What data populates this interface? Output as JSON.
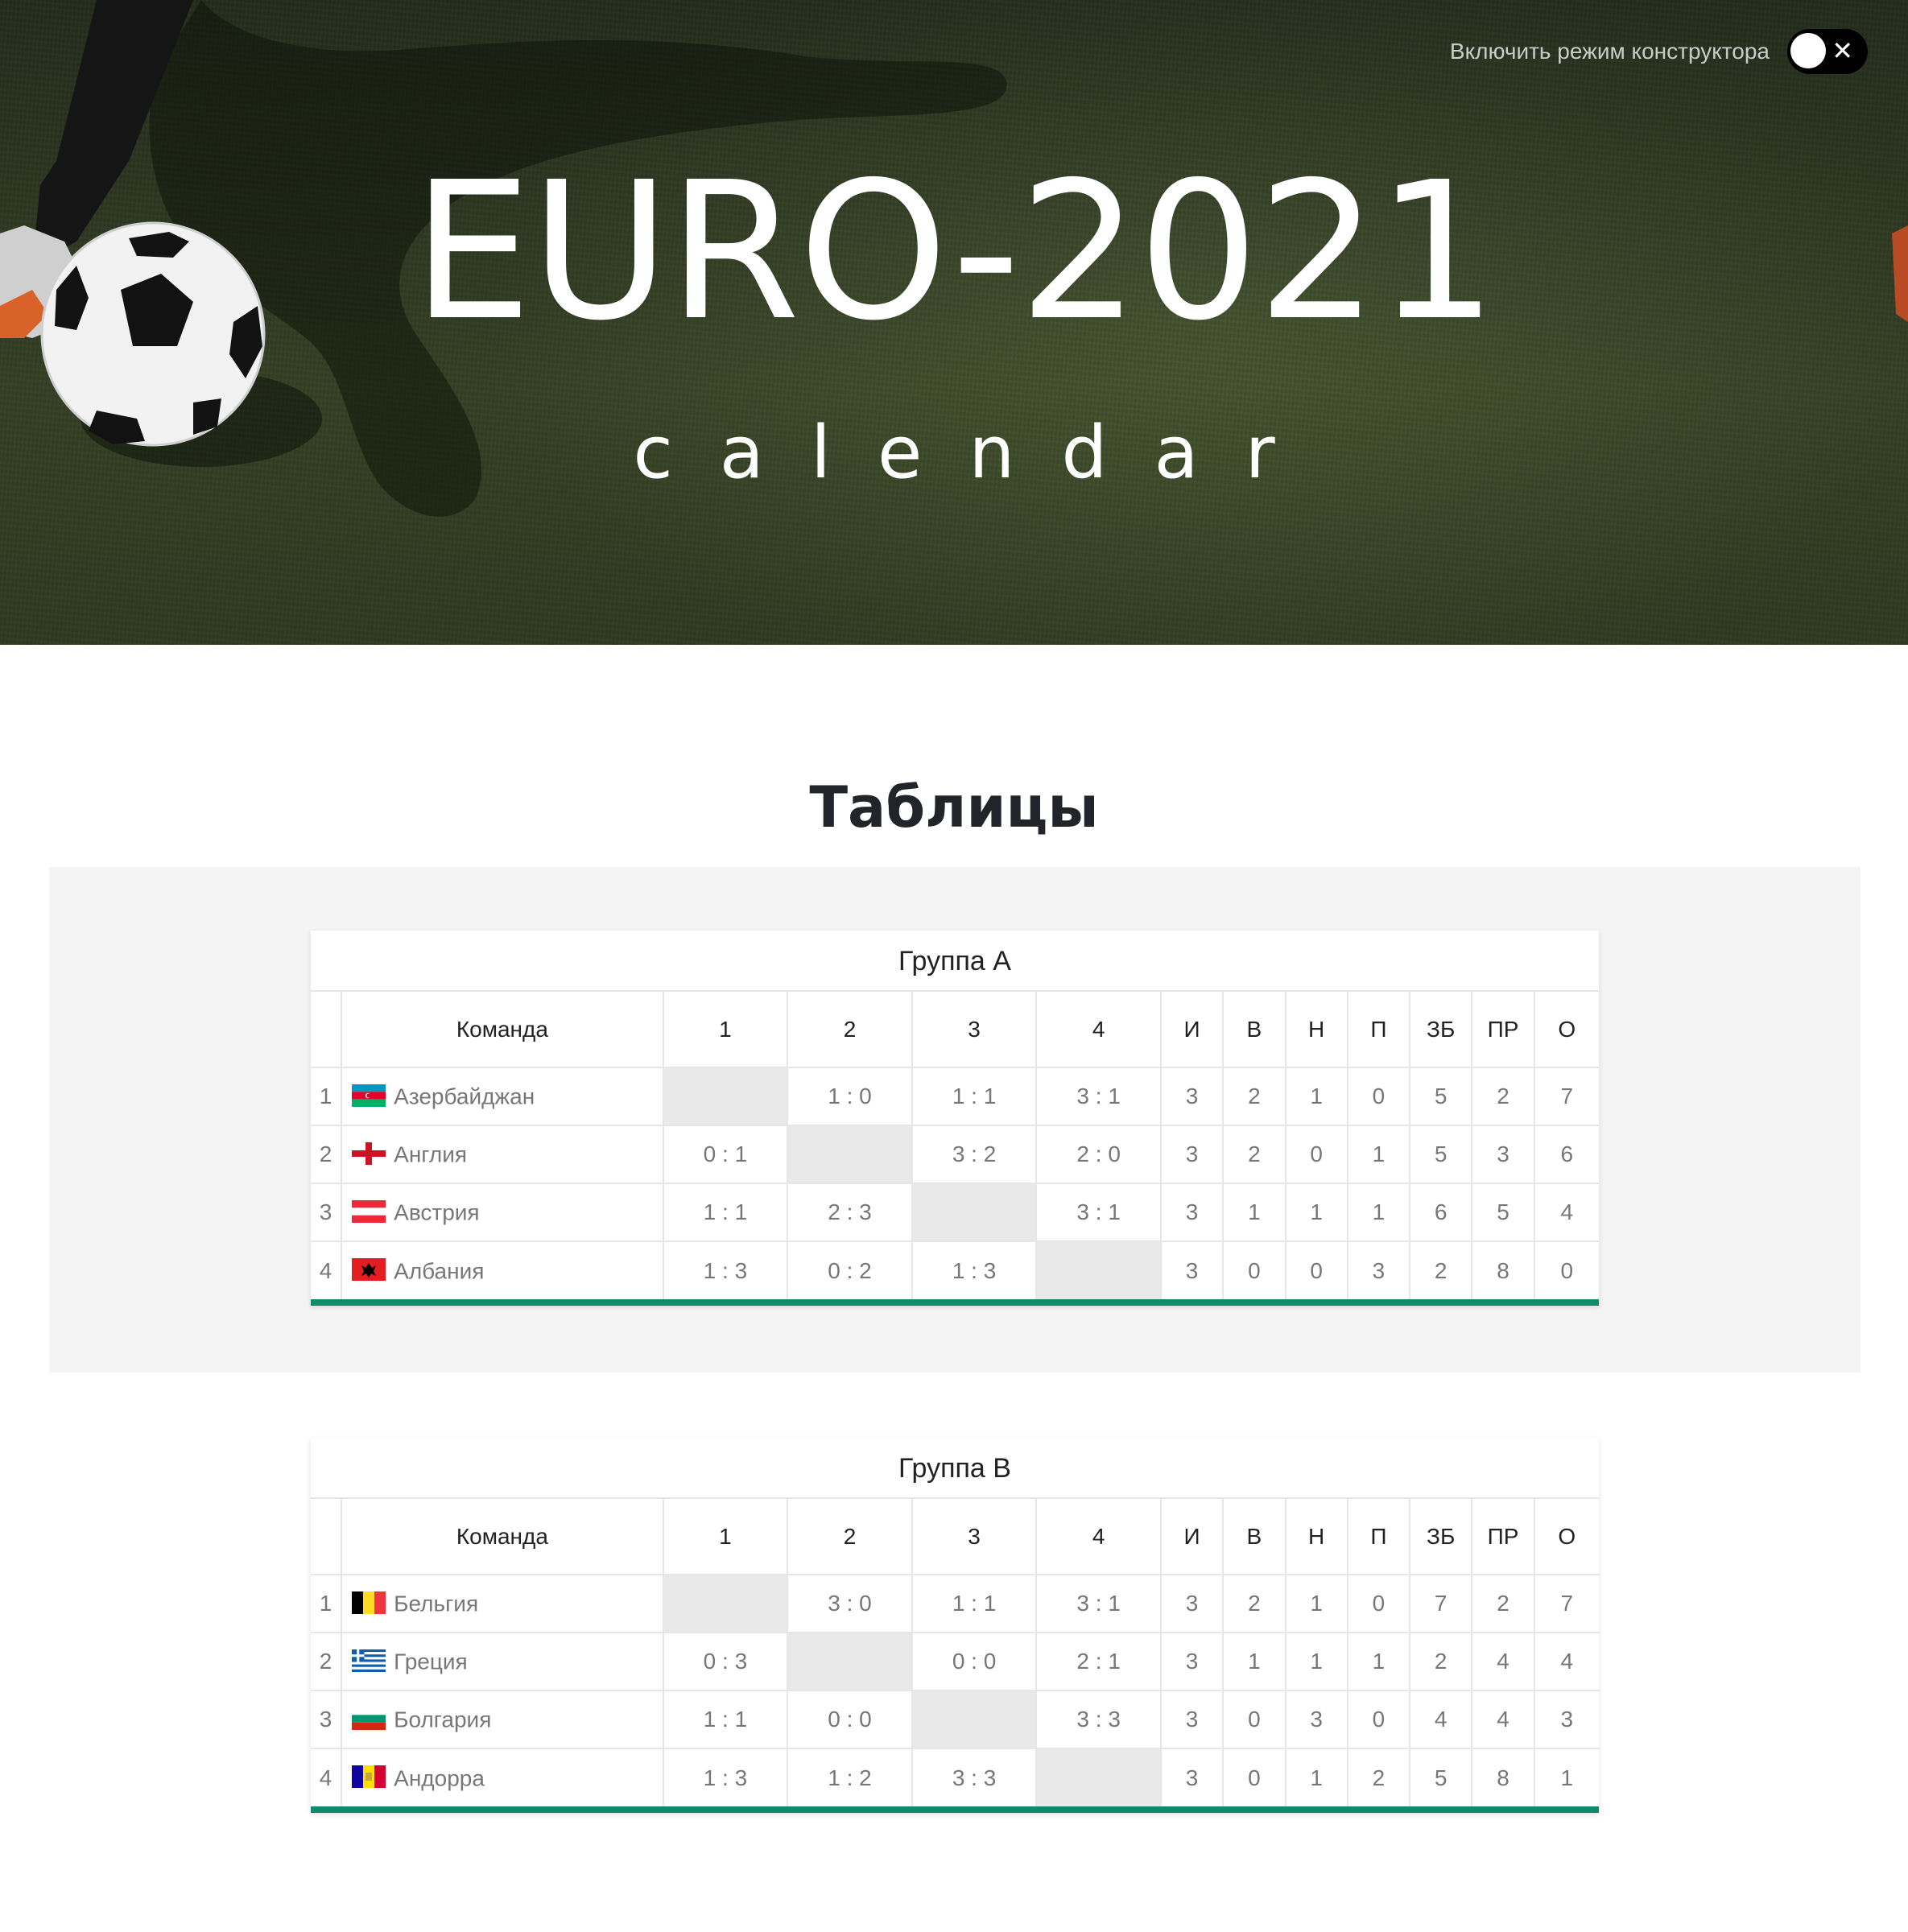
{
  "header": {
    "title": "EURO-2021",
    "subtitle": "calendar",
    "constructor_label": "Включить режим конструктора",
    "constructor_enabled": false
  },
  "section": {
    "title": "Таблицы"
  },
  "table_columns": [
    "Команда",
    "1",
    "2",
    "3",
    "4",
    "И",
    "В",
    "Н",
    "П",
    "ЗБ",
    "ПР",
    "О"
  ],
  "colors": {
    "accent": "#0f8a6a",
    "self_cell": "#e9e9e9",
    "panel_bg": "#f4f4f4"
  },
  "groups": [
    {
      "name": "Группа А",
      "rows": [
        {
          "pos": "1",
          "team": "Азербайджан",
          "flag": "azerbaijan",
          "results": [
            "",
            "1 : 0",
            "1 : 1",
            "3 : 1"
          ],
          "stats": [
            "3",
            "2",
            "1",
            "0",
            "5",
            "2",
            "7"
          ]
        },
        {
          "pos": "2",
          "team": "Англия",
          "flag": "england",
          "results": [
            "0 : 1",
            "",
            "3 : 2",
            "2 : 0"
          ],
          "stats": [
            "3",
            "2",
            "0",
            "1",
            "5",
            "3",
            "6"
          ]
        },
        {
          "pos": "3",
          "team": "Австрия",
          "flag": "austria",
          "results": [
            "1 : 1",
            "2 : 3",
            "",
            "3 : 1"
          ],
          "stats": [
            "3",
            "1",
            "1",
            "1",
            "6",
            "5",
            "4"
          ]
        },
        {
          "pos": "4",
          "team": "Албания",
          "flag": "albania",
          "results": [
            "1 : 3",
            "0 : 2",
            "1 : 3",
            ""
          ],
          "stats": [
            "3",
            "0",
            "0",
            "3",
            "2",
            "8",
            "0"
          ]
        }
      ]
    },
    {
      "name": "Группа В",
      "rows": [
        {
          "pos": "1",
          "team": "Бельгия",
          "flag": "belgium",
          "results": [
            "",
            "3 : 0",
            "1 : 1",
            "3 : 1"
          ],
          "stats": [
            "3",
            "2",
            "1",
            "0",
            "7",
            "2",
            "7"
          ]
        },
        {
          "pos": "2",
          "team": "Греция",
          "flag": "greece",
          "results": [
            "0 : 3",
            "",
            "0 : 0",
            "2 : 1"
          ],
          "stats": [
            "3",
            "1",
            "1",
            "1",
            "2",
            "4",
            "4"
          ]
        },
        {
          "pos": "3",
          "team": "Болгария",
          "flag": "bulgaria",
          "results": [
            "1 : 1",
            "0 : 0",
            "",
            "3 : 3"
          ],
          "stats": [
            "3",
            "0",
            "3",
            "0",
            "4",
            "4",
            "3"
          ]
        },
        {
          "pos": "4",
          "team": "Андорра",
          "flag": "andorra",
          "results": [
            "1 : 3",
            "1 : 2",
            "3 : 3",
            ""
          ],
          "stats": [
            "3",
            "0",
            "1",
            "2",
            "5",
            "8",
            "1"
          ]
        }
      ]
    }
  ]
}
